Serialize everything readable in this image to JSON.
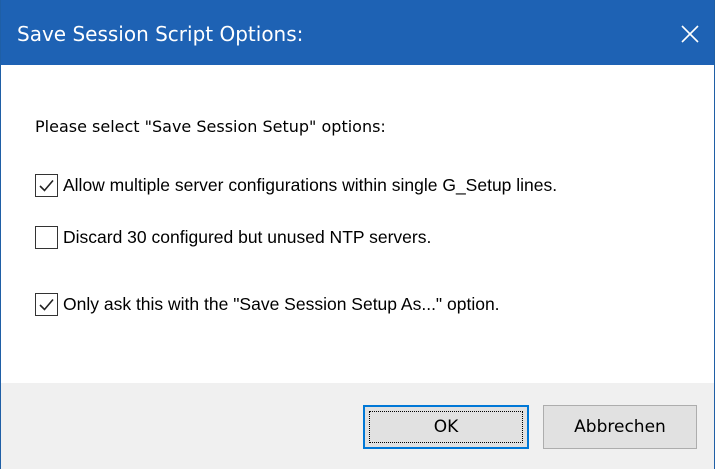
{
  "window": {
    "title": "Save Session Script Options:",
    "close_icon": "close-icon"
  },
  "content": {
    "prompt": "Please select \"Save Session Setup\" options:",
    "options": [
      {
        "label": "Allow multiple server configurations within single G_Setup lines.",
        "checked": true
      },
      {
        "label": "Discard 30 configured but unused NTP servers.",
        "checked": false
      },
      {
        "label": "Only ask this with the \"Save Session Setup As...\" option.",
        "checked": true
      }
    ]
  },
  "buttons": {
    "ok_label": "OK",
    "cancel_label": "Abbrechen"
  },
  "colors": {
    "titlebar": "#1e62b4",
    "ok_border": "#0078d7",
    "footer": "#f0f0f0"
  }
}
